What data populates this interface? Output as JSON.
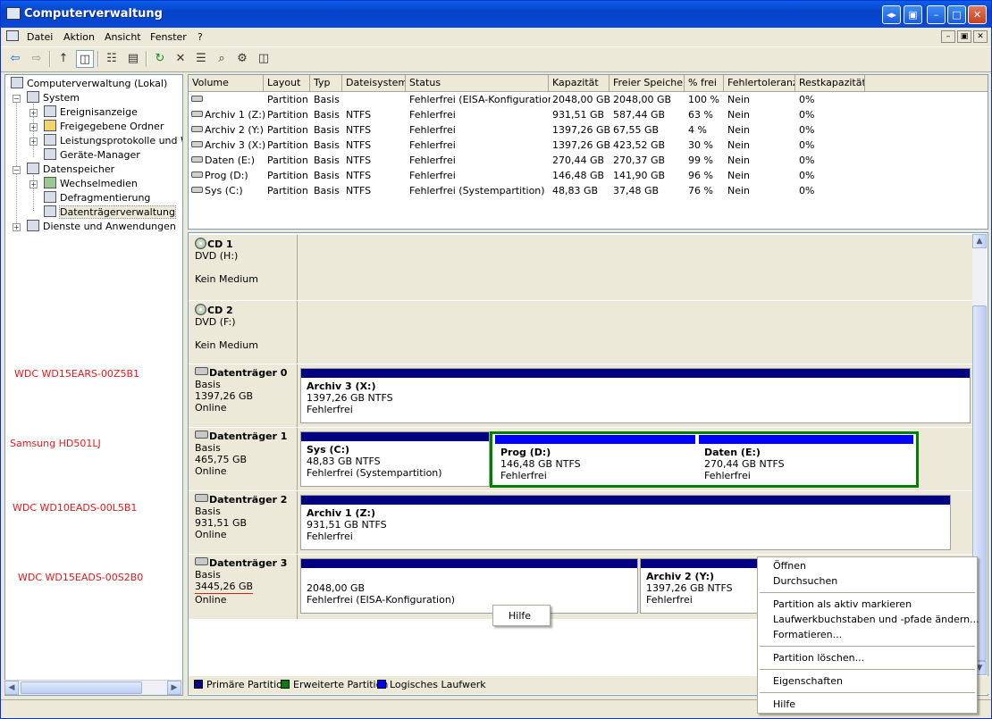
{
  "window": {
    "title": "Computerverwaltung",
    "buttons": [
      "◂▸",
      "▣",
      "–",
      "□",
      "✕"
    ]
  },
  "menubar": {
    "items": [
      "Datei",
      "Aktion",
      "Ansicht",
      "Fenster",
      "?"
    ]
  },
  "toolbar": {
    "icons": [
      "back-arrow-icon",
      "forward-arrow-icon",
      "up-folder-icon",
      "show-hide-tree-icon",
      "properties-icon",
      "export-list-icon",
      "refresh-icon",
      "delete-icon",
      "disk-properties-icon",
      "search-icon",
      "settings-icon"
    ],
    "glyphs": [
      "⇦",
      "⇨",
      "↑",
      "◫",
      "☷",
      "▤",
      "↻",
      "✕",
      "☰",
      "⌕",
      "⚙"
    ]
  },
  "tree": {
    "items": [
      {
        "label": "Computerverwaltung (Lokal)"
      },
      {
        "label": "System"
      },
      {
        "label": "Ereignisanzeige"
      },
      {
        "label": "Freigegebene Ordner"
      },
      {
        "label": "Leistungsprotokolle und Warnungen"
      },
      {
        "label": "Geräte-Manager"
      },
      {
        "label": "Datenspeicher"
      },
      {
        "label": "Wechselmedien"
      },
      {
        "label": "Defragmentierung"
      },
      {
        "label": "Datenträgerverwaltung"
      },
      {
        "label": "Dienste und Anwendungen"
      }
    ],
    "expanders": [
      "−",
      "+",
      "+",
      "+",
      "−",
      "+",
      "+"
    ]
  },
  "annotations": [
    "WDC WD15EARS-00Z5B1",
    "Samsung HD501LJ",
    "WDC WD10EADS-00L5B1",
    "WDC WD15EADS-00S2B0"
  ],
  "list": {
    "headers": [
      "Volume",
      "Layout",
      "Typ",
      "Dateisystem",
      "Status",
      "Kapazität",
      "Freier Speicher",
      "% frei",
      "Fehlertoleranz",
      "Restkapazität"
    ],
    "rows": [
      [
        "",
        "Partition",
        "Basis",
        "",
        "Fehlerfrei (EISA-Konfiguration)",
        "2048,00 GB",
        "2048,00 GB",
        "100 %",
        "Nein",
        "0%"
      ],
      [
        "Archiv 1 (Z:)",
        "Partition",
        "Basis",
        "NTFS",
        "Fehlerfrei",
        "931,51 GB",
        "587,44 GB",
        "63 %",
        "Nein",
        "0%"
      ],
      [
        "Archiv 2 (Y:)",
        "Partition",
        "Basis",
        "NTFS",
        "Fehlerfrei",
        "1397,26 GB",
        "67,55 GB",
        "4 %",
        "Nein",
        "0%"
      ],
      [
        "Archiv 3 (X:)",
        "Partition",
        "Basis",
        "NTFS",
        "Fehlerfrei",
        "1397,26 GB",
        "423,52 GB",
        "30 %",
        "Nein",
        "0%"
      ],
      [
        "Daten (E:)",
        "Partition",
        "Basis",
        "NTFS",
        "Fehlerfrei",
        "270,44 GB",
        "270,37 GB",
        "99 %",
        "Nein",
        "0%"
      ],
      [
        "Prog (D:)",
        "Partition",
        "Basis",
        "NTFS",
        "Fehlerfrei",
        "146,48 GB",
        "141,90 GB",
        "96 %",
        "Nein",
        "0%"
      ],
      [
        "Sys (C:)",
        "Partition",
        "Basis",
        "NTFS",
        "Fehlerfrei (Systempartition)",
        "48,83 GB",
        "37,48 GB",
        "76 %",
        "Nein",
        "0%"
      ]
    ]
  },
  "disks": {
    "cd1": {
      "name": "CD 1",
      "line1": "DVD (H:)",
      "line2": "Kein Medium"
    },
    "cd2": {
      "name": "CD 2",
      "line1": "DVD (F:)",
      "line2": "Kein Medium"
    },
    "d0": {
      "name": "Datenträger 0",
      "type": "Basis",
      "size": "1397,26 GB",
      "state": "Online",
      "p1": {
        "name": "Archiv 3  (X:)",
        "size": "1397,26 GB NTFS",
        "status": "Fehlerfrei"
      }
    },
    "d1": {
      "name": "Datenträger 1",
      "type": "Basis",
      "size": "465,75 GB",
      "state": "Online",
      "p1": {
        "name": "Sys  (C:)",
        "size": "48,83 GB NTFS",
        "status": "Fehlerfrei (Systempartition)"
      },
      "p2": {
        "name": "Prog  (D:)",
        "size": "146,48 GB NTFS",
        "status": "Fehlerfrei"
      },
      "p3": {
        "name": "Daten  (E:)",
        "size": "270,44 GB NTFS",
        "status": "Fehlerfrei"
      }
    },
    "d2": {
      "name": "Datenträger 2",
      "type": "Basis",
      "size": "931,51 GB",
      "state": "Online",
      "p1": {
        "name": "Archiv 1  (Z:)",
        "size": "931,51 GB NTFS",
        "status": "Fehlerfrei"
      }
    },
    "d3": {
      "name": "Datenträger 3",
      "type": "Basis",
      "size": "3445,26 GB",
      "state": "Online",
      "p1": {
        "size": "2048,00 GB",
        "status": "Fehlerfrei (EISA-Konfiguration)"
      },
      "p2": {
        "name": "Archiv 2  (Y:)",
        "size": "1397,26 GB NTFS",
        "status": "Fehlerfrei"
      }
    }
  },
  "legend": [
    "Primäre Partition",
    "Erweiterte Partition",
    "Logisches Laufwerk"
  ],
  "colors": {
    "primary": "#000080",
    "extended": "#008000",
    "logical": "#0000ff",
    "annotation": "#e21a1a"
  },
  "small_menu": {
    "items": [
      "Hilfe"
    ]
  },
  "context_menu": {
    "items": [
      "Öffnen",
      "Durchsuchen",
      "Partition als aktiv markieren",
      "Laufwerkbuchstaben und -pfade ändern...",
      "Formatieren...",
      "Partition löschen...",
      "Eigenschaften",
      "Hilfe"
    ]
  }
}
